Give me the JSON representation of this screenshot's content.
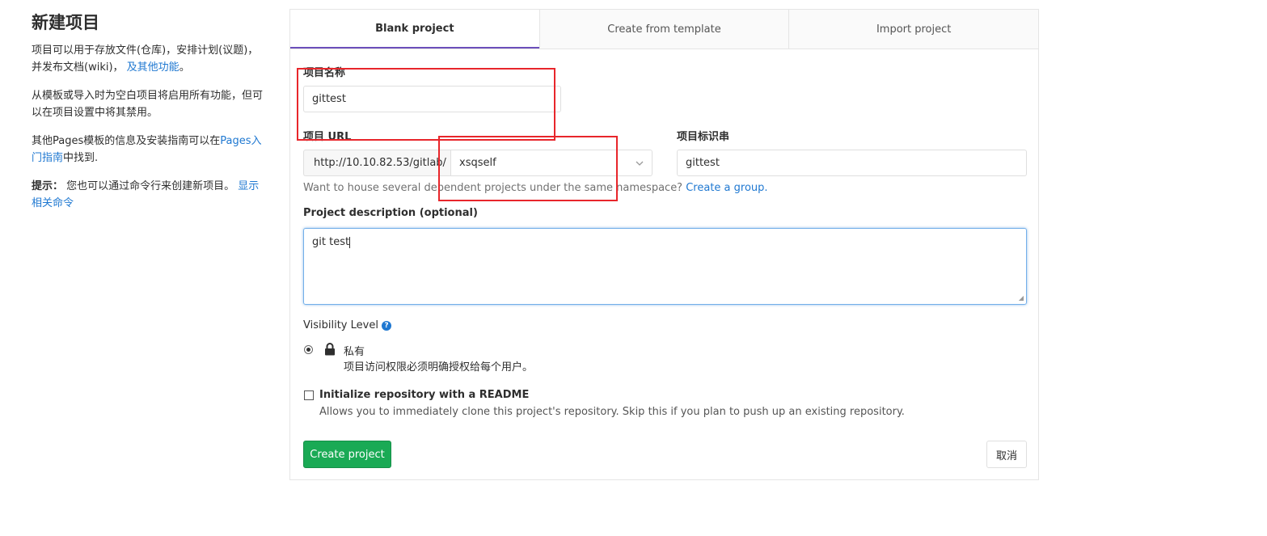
{
  "sidebar": {
    "title": "新建项目",
    "p1_text": "项目可以用于存放文件(仓库)，安排计划(议题)，并发布文档(wiki)，",
    "p1_link": "及其他功能",
    "p1_end": "。",
    "p2_text": "从模板或导入时为空白项目将启用所有功能，但可以在项目设置中将其禁用。",
    "p3_text": "其他Pages模板的信息及安装指南可以在",
    "p3_link": "Pages入门指南",
    "p3_end": "中找到.",
    "p4_bold": "提示：",
    "p4_text": " 您也可以通过命令行来创建新项目。 ",
    "p4_link": "显示相关命令"
  },
  "tabs": [
    {
      "label": "Blank project",
      "active": true
    },
    {
      "label": "Create from template",
      "active": false
    },
    {
      "label": "Import project",
      "active": false
    }
  ],
  "form": {
    "name_label": "项目名称",
    "name_value": "gittest",
    "url_label": "项目 URL",
    "url_prefix": "http://10.10.82.53/gitlab/",
    "namespace_value": "xsqself",
    "slug_label": "项目标识串",
    "slug_value": "gittest",
    "group_help": "Want to house several dependent projects under the same namespace? ",
    "group_link": "Create a group.",
    "desc_label": "Project description (optional)",
    "desc_value": "git test",
    "visibility_label": "Visibility Level",
    "visibility_option": "私有",
    "visibility_desc": "项目访问权限必须明确授权给每个用户。",
    "readme_label": "Initialize repository with a README",
    "readme_desc": "Allows you to immediately clone this project's repository. Skip this if you plan to push up an existing repository.",
    "create_button": "Create project",
    "cancel_button": "取消"
  },
  "colors": {
    "accent_tab": "#6b4fbb",
    "link": "#1f78d1",
    "create_button": "#1aaa55",
    "annotation": "#e8262b"
  }
}
